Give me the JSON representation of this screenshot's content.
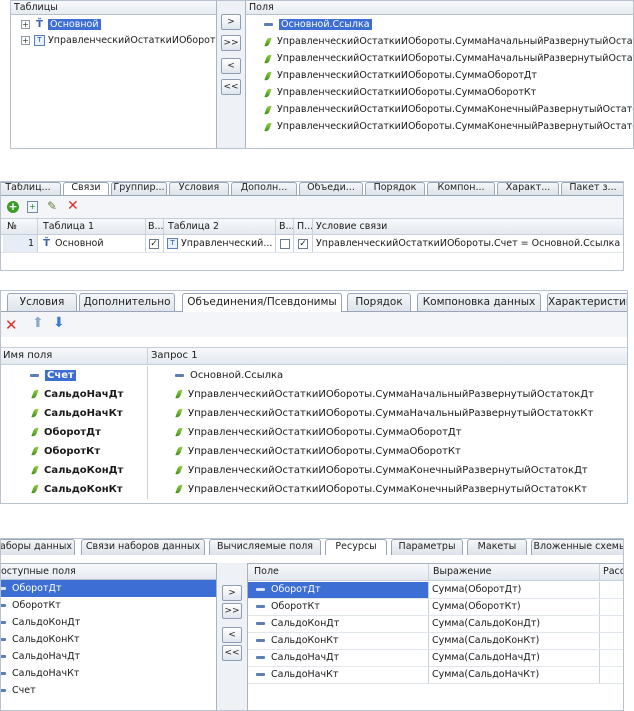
{
  "panel1": {
    "tables_header": "Таблицы",
    "fields_header": "Поля",
    "tables": [
      {
        "label": "Основной",
        "selected": true
      },
      {
        "label": "УправленческийОстаткиИОбороты",
        "selected": false
      }
    ],
    "buttons": [
      ">",
      ">>",
      "<",
      "<<"
    ],
    "fields": [
      {
        "label": "Основной.Ссылка",
        "selected": true,
        "icon": "dash"
      },
      {
        "label": "УправленческийОстаткиИОбороты.СуммаНачальныйРазвернутыйОстатокДт",
        "icon": "leaf"
      },
      {
        "label": "УправленческийОстаткиИОбороты.СуммаНачальныйРазвернутыйОстатокКт",
        "icon": "leaf"
      },
      {
        "label": "УправленческийОстаткиИОбороты.СуммаОборотДт",
        "icon": "leaf"
      },
      {
        "label": "УправленческийОстаткиИОбороты.СуммаОборотКт",
        "icon": "leaf"
      },
      {
        "label": "УправленческийОстаткиИОбороты.СуммаКонечныйРазвернутыйОстатокДт",
        "icon": "leaf"
      },
      {
        "label": "УправленческийОстаткиИОбороты.СуммаКонечныйРазвернутыйОстатокКт",
        "icon": "leaf"
      }
    ]
  },
  "panel2": {
    "tabs": [
      "Таблиц...",
      "Связи",
      "Группир...",
      "Условия",
      "Дополн...",
      "Объеди...",
      "Порядок",
      "Компон...",
      "Характ...",
      "Пакет з..."
    ],
    "active_tab": "Связи",
    "columns": [
      "№",
      "Таблица 1",
      "В...",
      "Таблица 2",
      "В...",
      "П...",
      "Условие связи"
    ],
    "row": {
      "num": "1",
      "table1": "Основной",
      "table2": "Управленческий...",
      "condition": "УправленческийОстаткиИОбороты.Счет = Основной.Ссылка"
    }
  },
  "panel3": {
    "tabs": [
      "Условия",
      "Дополнительно",
      "Объединения/Псевдонимы",
      "Порядок",
      "Компоновка данных",
      "Характеристики"
    ],
    "active_tab": "Объединения/Псевдонимы",
    "col_name": "Имя поля",
    "col_query": "Запрос 1",
    "rows": [
      {
        "name": "Счет",
        "query": "Основной.Ссылка",
        "icon": "dash",
        "selected": true
      },
      {
        "name": "СальдоНачДт",
        "query": "УправленческийОстаткиИОбороты.СуммаНачальныйРазвернутыйОстатокДт",
        "icon": "leaf"
      },
      {
        "name": "СальдоНачКт",
        "query": "УправленческийОстаткиИОбороты.СуммаНачальныйРазвернутыйОстатокКт",
        "icon": "leaf"
      },
      {
        "name": "ОборотДт",
        "query": "УправленческийОстаткиИОбороты.СуммаОборотДт",
        "icon": "leaf"
      },
      {
        "name": "ОборотКт",
        "query": "УправленческийОстаткиИОбороты.СуммаОборотКт",
        "icon": "leaf"
      },
      {
        "name": "СальдоКонДт",
        "query": "УправленческийОстаткиИОбороты.СуммаКонечныйРазвернутыйОстатокДт",
        "icon": "leaf"
      },
      {
        "name": "СальдоКонКт",
        "query": "УправленческийОстаткиИОбороты.СуммаКонечныйРазвернутыйОстатокКт",
        "icon": "leaf"
      }
    ]
  },
  "panel4": {
    "tabs": [
      "аборы данных",
      "Связи наборов данных",
      "Вычисляемые поля",
      "Ресурсы",
      "Параметры",
      "Макеты",
      "Вложенные схемы"
    ],
    "active_tab": "Ресурсы",
    "available_header": "оступные поля",
    "available": [
      "ОборотДт",
      "ОборотКт",
      "СальдоКонДт",
      "СальдоКонКт",
      "СальдоНачДт",
      "СальдоНачКт",
      "Счет"
    ],
    "buttons": [
      ">",
      ">>",
      "<",
      "<<"
    ],
    "col_field": "Поле",
    "col_expr": "Выражение",
    "col_calc": "Расс",
    "resources": [
      {
        "field": "ОборотДт",
        "expr": "Сумма(ОборотДт)"
      },
      {
        "field": "ОборотКт",
        "expr": "Сумма(ОборотКт)"
      },
      {
        "field": "СальдоКонДт",
        "expr": "Сумма(СальдоКонДт)"
      },
      {
        "field": "СальдоКонКт",
        "expr": "Сумма(СальдоКонКт)"
      },
      {
        "field": "СальдоНачДт",
        "expr": "Сумма(СальдоНачДт)"
      },
      {
        "field": "СальдоНачКт",
        "expr": "Сумма(СальдоНачКт)"
      }
    ]
  }
}
